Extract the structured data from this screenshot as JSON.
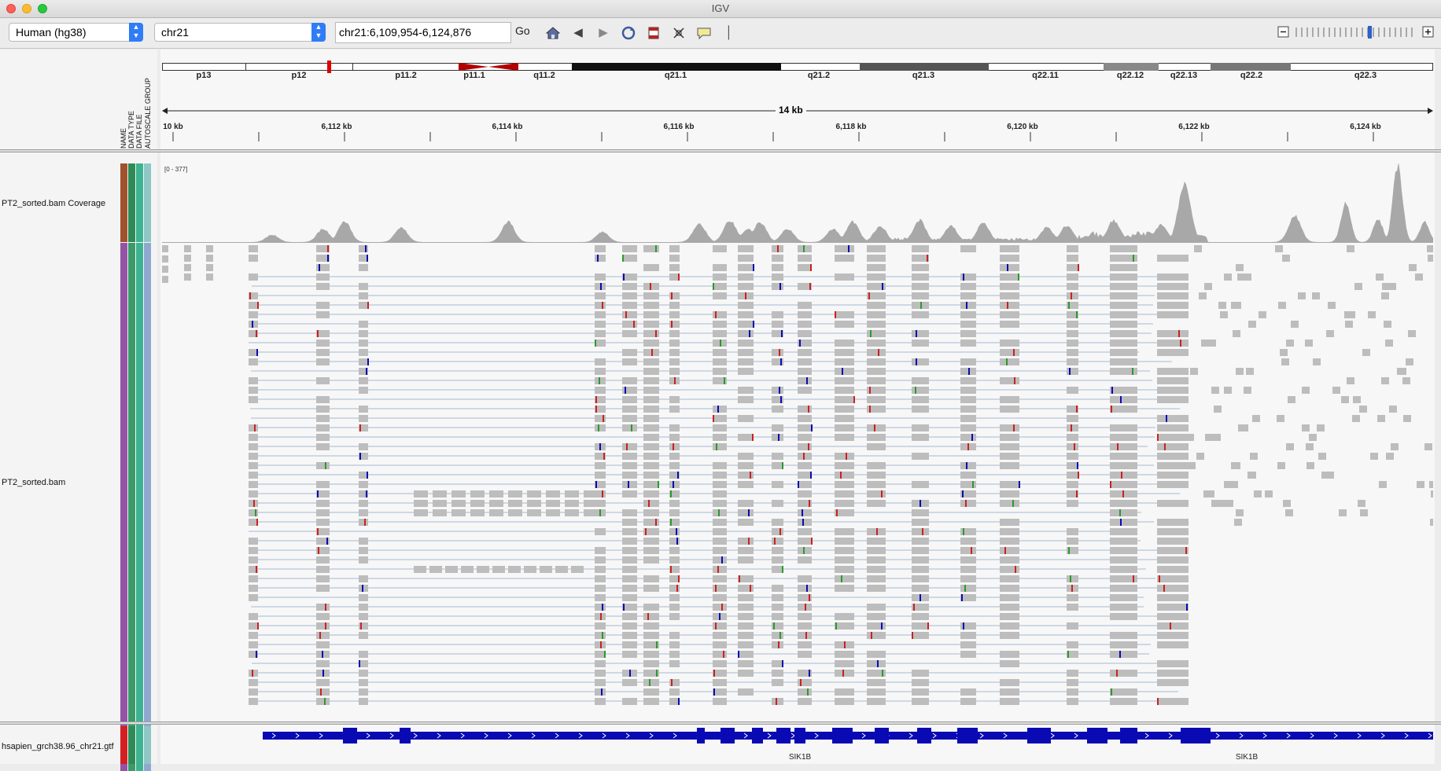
{
  "window": {
    "title": "IGV"
  },
  "toolbar": {
    "genome": "Human (hg38)",
    "chromosome": "chr21",
    "locus": "chr21:6,109,954-6,124,876",
    "go_label": "Go",
    "icons": [
      "home-icon",
      "back-icon",
      "forward-icon",
      "refresh-icon",
      "region-icon",
      "resize-icon",
      "popup-text-icon",
      "ruler-divider"
    ]
  },
  "ideogram": {
    "bands": [
      "p13",
      "p12",
      "p11.2",
      "p11.1",
      "q11.2",
      "q21.1",
      "q21.2",
      "q21.3",
      "q22.11",
      "q22.12",
      "q22.13",
      "q22.2",
      "q22.3"
    ]
  },
  "ruler": {
    "span": "14 kb",
    "ticks": [
      "10 kb",
      "6,112 kb",
      "6,114 kb",
      "6,116 kb",
      "6,118 kb",
      "6,120 kb",
      "6,122 kb",
      "6,124 kb"
    ]
  },
  "attribute_headers": [
    "NAME",
    "DATA TYPE",
    "DATA FILE",
    "AUTOSCALE GROUP"
  ],
  "tracks": {
    "coverage": {
      "name": "PT2_sorted.bam Coverage",
      "range": "[0 - 377]"
    },
    "alignments": {
      "name": "PT2_sorted.bam"
    },
    "annotation": {
      "name": "hsapien_grch38.96_chr21.gtf",
      "genes": [
        "SIK1B",
        "SIK1B"
      ]
    }
  },
  "colors": {
    "strand_blue": "#0a0ab4",
    "mismatch_red": "#cc2020",
    "read_gray": "#bdbdbd",
    "coverage_gray": "#a8a8a8",
    "centromere": "#b00000"
  }
}
